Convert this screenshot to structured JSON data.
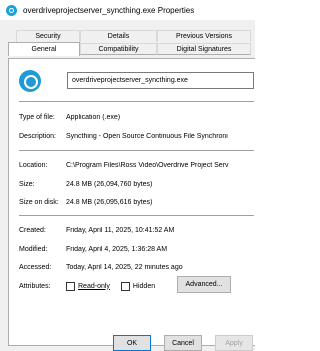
{
  "window": {
    "title": "overdriveprojectserver_syncthing.exe Properties"
  },
  "tabs": {
    "row1": [
      "Security",
      "Details",
      "Previous Versions"
    ],
    "row2": [
      "General",
      "Compatibility",
      "Digital Signatures"
    ],
    "active": "General"
  },
  "general": {
    "file_name": "overdriveprojectserver_syncthing.exe",
    "type_label": "Type of file:",
    "type_value": "Application (.exe)",
    "description_label": "Description:",
    "description_value": "Syncthing - Open Source Continuous File Synchroni",
    "location_label": "Location:",
    "location_value": "C:\\Program Files\\Ross Video\\Overdrive Project Serv",
    "size_label": "Size:",
    "size_value": "24.8 MB (26,094,760 bytes)",
    "size_on_disk_label": "Size on disk:",
    "size_on_disk_value": "24.8 MB (26,095,616 bytes)",
    "created_label": "Created:",
    "created_value": "Friday, April 11, 2025, 10:41:52 AM",
    "modified_label": "Modified:",
    "modified_value": "Friday, April 4, 2025, 1:36:28 AM",
    "accessed_label": "Accessed:",
    "accessed_value": "Today, April 14, 2025, 22 minutes ago",
    "attributes_label": "Attributes:",
    "readonly_label": "Read-only",
    "hidden_label": "Hidden",
    "advanced_label": "Advanced..."
  },
  "buttons": {
    "ok": "OK",
    "cancel": "Cancel",
    "apply": "Apply"
  },
  "colors": {
    "accent": "#0078d7",
    "icon_blue": "#1e9bd7"
  }
}
